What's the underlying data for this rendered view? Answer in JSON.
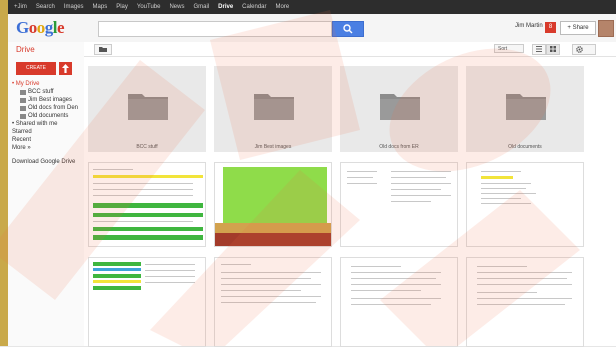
{
  "topbar": {
    "items": [
      "+Jim",
      "Search",
      "Images",
      "Maps",
      "Play",
      "YouTube",
      "News",
      "Gmail",
      "Drive",
      "Calendar",
      "More"
    ]
  },
  "header": {
    "logo_letters": [
      {
        "ch": "G",
        "color": "b"
      },
      {
        "ch": "o",
        "color": "r"
      },
      {
        "ch": "o",
        "color": "y"
      },
      {
        "ch": "g",
        "color": "b"
      },
      {
        "ch": "l",
        "color": "g"
      },
      {
        "ch": "e",
        "color": "r"
      }
    ],
    "search_placeholder": "",
    "user_name": "Jim Martin",
    "notifications": "8",
    "share_label": "+ Share"
  },
  "sidebar": {
    "title": "Drive",
    "create_label": "CREATE",
    "my_drive": "• My Drive",
    "folders": [
      "BCC stuff",
      "Jim Best images",
      "Old docs from Den",
      "Old documents"
    ],
    "links": [
      "• Shared with me",
      "Starred",
      "Recent",
      "More »"
    ],
    "download_label": "Download Google Drive"
  },
  "toolbar": {
    "sort_label": "Sort"
  },
  "folders": [
    {
      "name": "BCC stuff"
    },
    {
      "name": "Jim Best images"
    },
    {
      "name": "Old docs from ER"
    },
    {
      "name": "Old documents"
    }
  ],
  "colors": {
    "accent_red": "#d83a2b",
    "search_blue": "#4a7fe3",
    "sheet_green": "#3fb63f",
    "watermark": "#ef6a44"
  }
}
